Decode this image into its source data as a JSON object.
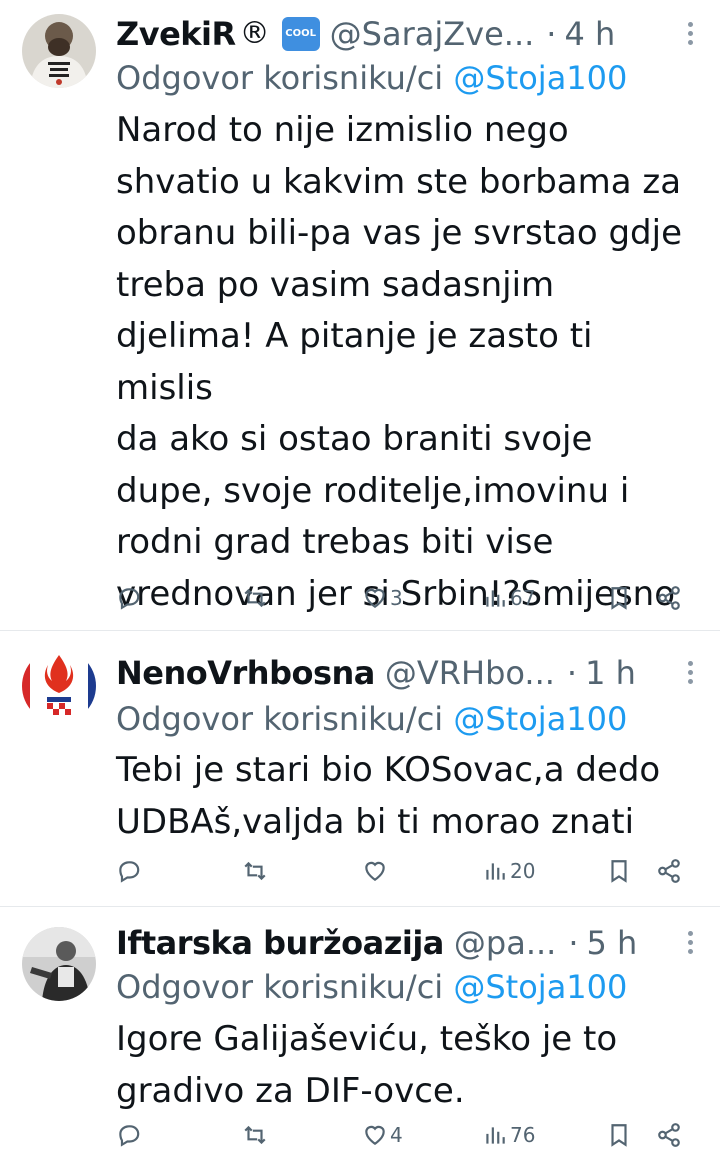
{
  "tweets": [
    {
      "name": "ZvekiR",
      "name_suffix": "®",
      "badge": "COOL",
      "handle": "@SarajZve...",
      "time": "4 h",
      "reply_prefix": "Odgovor korisniku/ci",
      "reply_mention": "@Stoja100",
      "body": "Narod to nije izmislio nego\nshvatio u kakvim ste borbama za\nobranu bili-pa vas je svrstao gdje\ntreba po vasim sadasnjim\ndjelima! A pitanje je zasto ti mislis\nda ako si ostao braniti svoje\ndupe, svoje roditelje,imovinu i\nrodni grad trebas biti vise\nvrednovan jer si Srbin!?Smijesno",
      "likes": "3",
      "views": "67"
    },
    {
      "name": "NenoVrhbosna",
      "handle": "@VRHbo...",
      "time": "1 h",
      "reply_prefix": "Odgovor korisniku/ci",
      "reply_mention": "@Stoja100",
      "body": "Tebi je stari bio KOSovac,a dedo\nUDBAš,valjda bi ti morao znati",
      "likes": "",
      "views": "20"
    },
    {
      "name": "Iftarska buržoazija",
      "handle": "@pa...",
      "time": "5 h",
      "reply_prefix": "Odgovor korisniku/ci",
      "reply_mention": "@Stoja100",
      "body": "Igore Galijaševiću, teško je to\ngradivo za DIF-ovce.",
      "likes": "4",
      "views": "76"
    }
  ],
  "dot_separator": "·",
  "colors": {
    "text": "#0f1419",
    "muted": "#536471",
    "link": "#1d9bf0"
  },
  "icons": [
    "reply-icon",
    "retweet-icon",
    "like-icon",
    "views-icon",
    "bookmark-icon",
    "share-icon",
    "more-icon"
  ]
}
